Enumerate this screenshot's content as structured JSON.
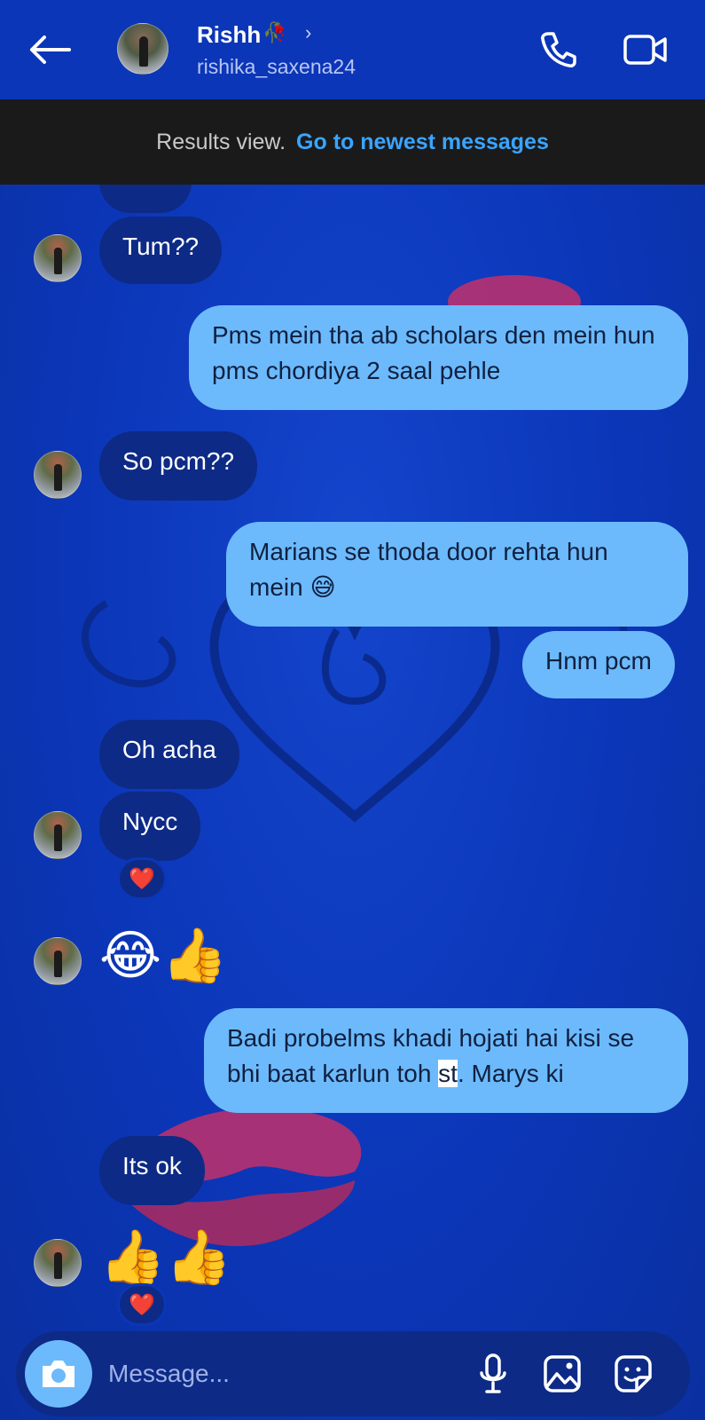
{
  "header": {
    "name": "Rishh",
    "name_emoji": "🥀",
    "chevron": "›",
    "username": "rishika_saxena24",
    "icons": [
      "back-arrow-icon",
      "phone-icon",
      "video-camera-icon"
    ]
  },
  "banner": {
    "text": "Results view.",
    "link": "Go to newest messages"
  },
  "messages": [
    {
      "side": "in",
      "text": "Tum??"
    },
    {
      "side": "out",
      "text": "Pms mein tha ab scholars den mein hun pms chordiya 2 saal pehle"
    },
    {
      "side": "in",
      "text": "So pcm??"
    },
    {
      "side": "out",
      "text": "Marians se thoda door rehta hun mein 😅"
    },
    {
      "side": "out",
      "text": "Hnm pcm"
    },
    {
      "side": "in",
      "text": "Oh acha"
    },
    {
      "side": "in",
      "text": "Nycc",
      "reaction": "❤️"
    },
    {
      "side": "in",
      "text": "😂👍"
    },
    {
      "side": "out",
      "text_before": "Badi probelms khadi hojati hai kisi se bhi baat karlun toh ",
      "text_highlight": "st",
      "text_after": ". Marys ki"
    },
    {
      "side": "in",
      "text": "Its ok"
    },
    {
      "side": "in",
      "text": "👍👍",
      "reaction": "❤️"
    }
  ],
  "composer": {
    "placeholder": "Message...",
    "icons": [
      "camera-icon",
      "microphone-icon",
      "gallery-icon",
      "sticker-icon"
    ]
  },
  "colors": {
    "background": "#0b36b8",
    "incoming_bubble": "#0d2a86",
    "outgoing_bubble": "#6cbafc",
    "link": "#3aa4ff",
    "banner": "#1a1a1a"
  }
}
